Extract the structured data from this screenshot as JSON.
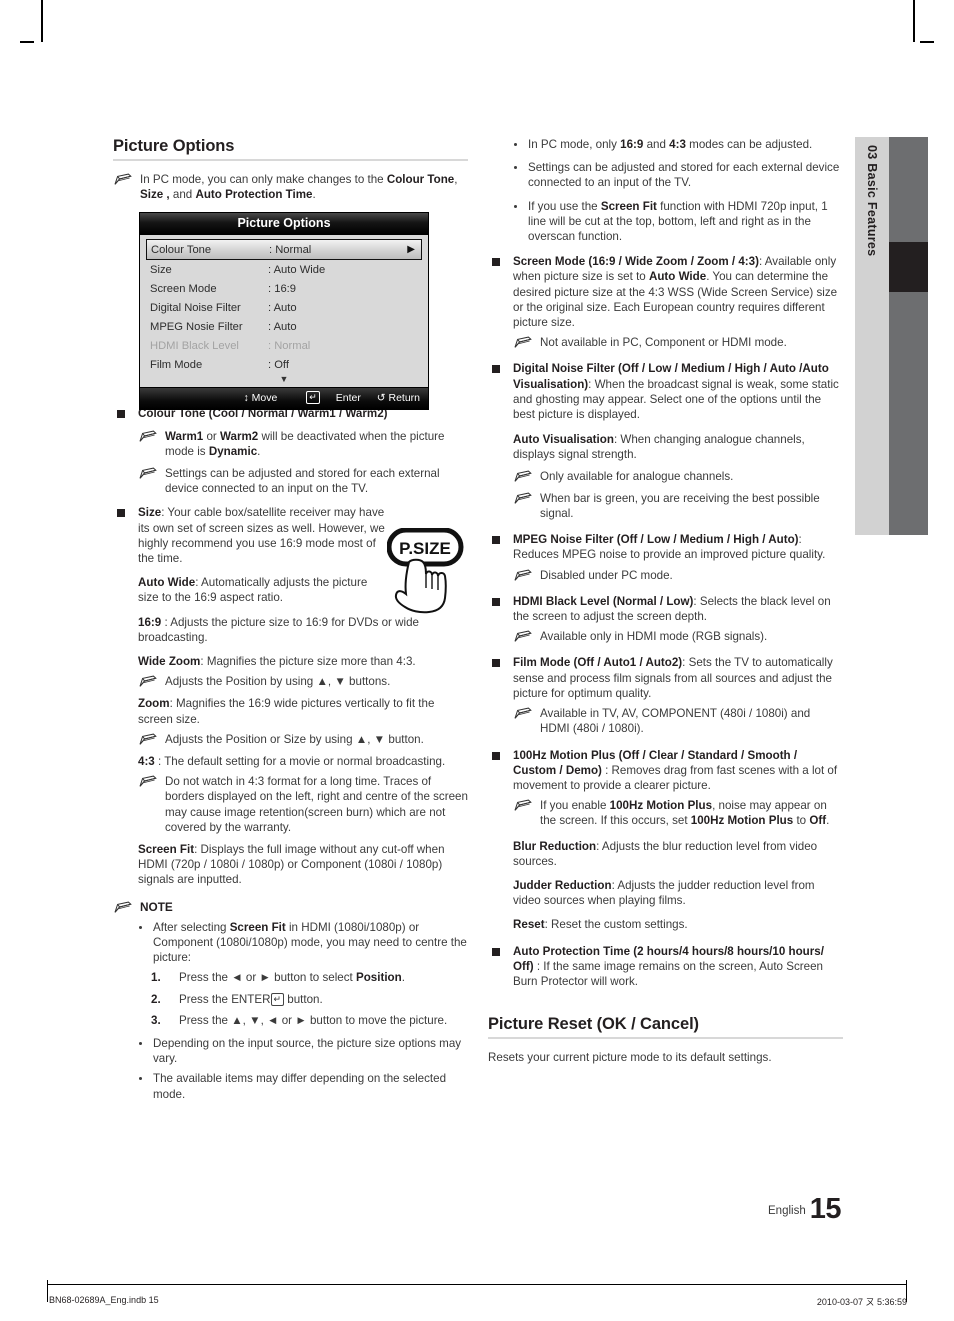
{
  "page": {
    "language": "English",
    "number": "15",
    "chapter_number": "03",
    "chapter_title": "Basic Features"
  },
  "footer": {
    "file": "BN68-02689A_Eng.indb   15",
    "timestamp": "2010-03-07   ㄡ 5:36:59"
  },
  "left_column": {
    "heading": "Picture Options",
    "intro_note": {
      "icon": "pencil-note-icon",
      "t1": "In PC mode, you can only make changes to the ",
      "b1": "Colour Tone",
      "t2": ", ",
      "b2": "Size ,",
      "t3": " and ",
      "b3": "Auto Protection Time",
      "t4": "."
    },
    "osd": {
      "title": "Picture Options",
      "rows": [
        {
          "label": "Colour Tone",
          "value": ": Normal",
          "selected": true,
          "dimmed": false,
          "arrow": "▶"
        },
        {
          "label": "Size",
          "value": ": Auto Wide",
          "selected": false,
          "dimmed": false,
          "arrow": ""
        },
        {
          "label": "Screen Mode",
          "value": ": 16:9",
          "selected": false,
          "dimmed": false,
          "arrow": ""
        },
        {
          "label": "Digital Noise Filter",
          "value": ": Auto",
          "selected": false,
          "dimmed": false,
          "arrow": ""
        },
        {
          "label": "MPEG Nosie Filter",
          "value": ": Auto",
          "selected": false,
          "dimmed": false,
          "arrow": ""
        },
        {
          "label": "HDMI Black Level",
          "value": ": Normal",
          "selected": false,
          "dimmed": true,
          "arrow": ""
        },
        {
          "label": "Film Mode",
          "value": ": Off",
          "selected": false,
          "dimmed": false,
          "arrow": ""
        }
      ],
      "scroll_glyph": "▼",
      "footer": {
        "move": "↕ Move",
        "enter_label": "Enter",
        "enter_glyph": "↵",
        "return": "↺ Return"
      }
    },
    "colour_tone": {
      "title": "Colour Tone (Cool / Normal / Warm1 / Warm2)",
      "note1": {
        "b1": "Warm1",
        "t1": " or ",
        "b2": "Warm2",
        "t2": " will be deactivated when the picture mode is ",
        "b3": "Dynamic",
        "t3": "."
      },
      "note2": "Settings can be adjusted and stored for each external device connected to an input on the TV."
    },
    "size": {
      "bold": "Size",
      "text": ": Your cable box/satellite receiver may have its own set of screen sizes as well. However, we highly recommend you use 16:9 mode most of the time.",
      "button_art_label": "P.SIZE",
      "items": [
        {
          "bold": "Auto Wide",
          "text": ": Automatically adjusts the picture size to the 16:9 aspect ratio."
        },
        {
          "bold": "16:9",
          "text": " : Adjusts the picture size to 16:9 for DVDs or wide broadcasting."
        },
        {
          "bold": "Wide Zoom",
          "text": ": Magnifies the picture size more than 4:3."
        }
      ],
      "note_wide_zoom": "Adjusts the Position by using ▲, ▼ buttons.",
      "zoom": {
        "bold": "Zoom",
        "text": ": Magnifies the 16:9 wide pictures vertically to fit the screen size."
      },
      "note_zoom": "Adjusts the Position or Size by using ▲, ▼ button.",
      "four_three": {
        "bold": "4:3",
        "text": " : The default setting for a movie or normal broadcasting."
      },
      "note_four_three": "Do not watch in 4:3 format for a long time. Traces of borders displayed on the left, right and centre of the screen may cause image retention(screen burn) which are not covered by the warranty.",
      "screen_fit": {
        "bold": "Screen Fit",
        "text": ": Displays the full image without any cut-off when HDMI (720p / 1080i / 1080p) or Component (1080i / 1080p) signals are inputted."
      }
    },
    "note_block": {
      "label": "NOTE",
      "bullet1": {
        "t1": "After selecting ",
        "b1": "Screen Fit",
        "t2": " in HDMI (1080i/1080p) or Component (1080i/1080p) mode, you may need to centre the picture:"
      },
      "steps": [
        {
          "num": "1.",
          "t1": "Press the ◄ or ► button to select ",
          "b1": "Position",
          "t2": "."
        },
        {
          "num": "2.",
          "t1": "Press the ENTER",
          "glyph": "↵",
          "t2": " button."
        },
        {
          "num": "3.",
          "t1": "Press the ▲, ▼, ◄ or ► button to move the picture.",
          "glyph": "",
          "t2": ""
        }
      ],
      "bullet2": "Depending on the input source, the picture size options may vary.",
      "bullet3": "The available items may differ depending on the selected mode."
    }
  },
  "right_column": {
    "top_bullets": [
      {
        "t1": "In PC mode, only ",
        "b1": "16:9",
        "t2": " and ",
        "b2": "4:3",
        "t3": " modes can be adjusted."
      },
      {
        "t1": "Settings can be adjusted and stored for each external device connected to an input of the TV.",
        "b1": "",
        "t2": "",
        "b2": "",
        "t3": ""
      },
      {
        "t1": "If you use the ",
        "b1": "Screen Fit",
        "t2": " function with HDMI 720p input, 1 line will be cut at the top, bottom, left and right as in the overscan function.",
        "b2": "",
        "t3": ""
      }
    ],
    "screen_mode": {
      "bold": "Screen Mode (16:9 / Wide Zoom / Zoom / 4:3)",
      "t1": ": Available only when picture size is set to ",
      "b2": "Auto Wide",
      "t2": ". You can determine the desired picture size at the 4:3 WSS (Wide Screen Service) size or the original size. Each European country requires different picture size.",
      "note": "Not available in PC, Component or HDMI mode."
    },
    "digital_noise_filter": {
      "bold": "Digital Noise Filter (Off / Low / Medium / High / Auto /Auto Visualisation)",
      "text": ": When the broadcast signal is weak, some static and ghosting may appear. Select one of the options until the best picture is displayed.",
      "sub_bold": "Auto Visualisation",
      "sub_text": ": When changing analogue channels, displays signal strength.",
      "note1": "Only available for analogue channels.",
      "note2": "When bar is green, you are receiving the best possible signal."
    },
    "mpeg_noise_filter": {
      "bold": "MPEG Noise Filter (Off / Low / Medium / High / Auto)",
      "text": ": Reduces MPEG noise to provide an improved picture quality.",
      "note": "Disabled under PC mode."
    },
    "hdmi_black_level": {
      "bold": "HDMI Black Level (Normal / Low)",
      "text": ": Selects the black level on the screen to adjust the screen depth.",
      "note": "Available only in HDMI mode (RGB signals)."
    },
    "film_mode": {
      "bold": "Film Mode (Off / Auto1 / Auto2)",
      "text": ": Sets the TV to automatically sense and process film signals from all sources and adjust the picture for optimum quality.",
      "note": "Available in TV, AV, COMPONENT (480i / 1080i) and HDMI (480i / 1080i)."
    },
    "motion_plus": {
      "bold": "100Hz Motion Plus (Off / Clear / Standard / Smooth / Custom / Demo)",
      "text": " : Removes drag from fast scenes with a lot of movement to provide a clearer picture.",
      "note": {
        "t1": "If you enable ",
        "b1": "100Hz Motion Plus",
        "t2": ", noise may appear on the screen. If this occurs, set ",
        "b2": "100Hz Motion Plus",
        "t3": " to ",
        "b3": "Off",
        "t4": "."
      },
      "blur": {
        "bold": "Blur Reduction",
        "text": ": Adjusts the blur reduction level from video sources."
      },
      "judder": {
        "bold": "Judder Reduction",
        "text": ": Adjusts the judder reduction level from video sources when playing films."
      },
      "reset": {
        "bold": "Reset",
        "text": ": Reset the custom settings."
      }
    },
    "auto_protection": {
      "bold": "Auto Protection Time (2 hours/4 hours/8 hours/10 hours/ Off)",
      "text": " : If the same image remains on the screen, Auto Screen Burn Protector will work."
    },
    "picture_reset": {
      "heading": "Picture Reset (OK / Cancel)",
      "text": "Resets your current picture mode to its default settings."
    }
  }
}
